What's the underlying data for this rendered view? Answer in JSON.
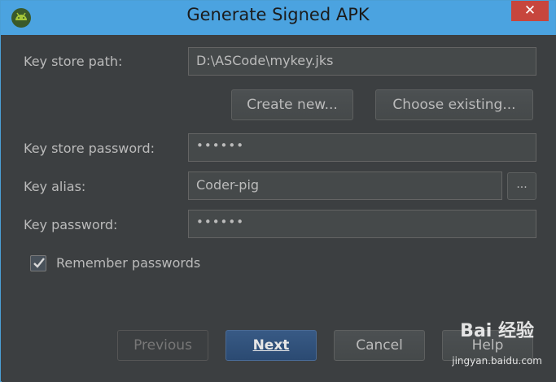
{
  "window": {
    "title": "Generate Signed APK",
    "close_glyph": "✕"
  },
  "form": {
    "key_store_path": {
      "label": "Key store path:",
      "value": "D:\\ASCode\\mykey.jks"
    },
    "create_new_label": "Create new...",
    "choose_existing_label": "Choose existing...",
    "key_store_password": {
      "label": "Key store password:",
      "value": "••••••"
    },
    "key_alias": {
      "label": "Key alias:",
      "value": "Coder-pig",
      "browse_label": "..."
    },
    "key_password": {
      "label": "Key password:",
      "value": "••••••"
    },
    "remember_passwords": {
      "label": "Remember passwords",
      "checked": true
    }
  },
  "footer": {
    "previous_label": "Previous",
    "next_label": "Next",
    "cancel_label": "Cancel",
    "help_label": "Help"
  },
  "watermark": {
    "brand": "Bai 经验",
    "url": "jingyan.baidu.com"
  }
}
